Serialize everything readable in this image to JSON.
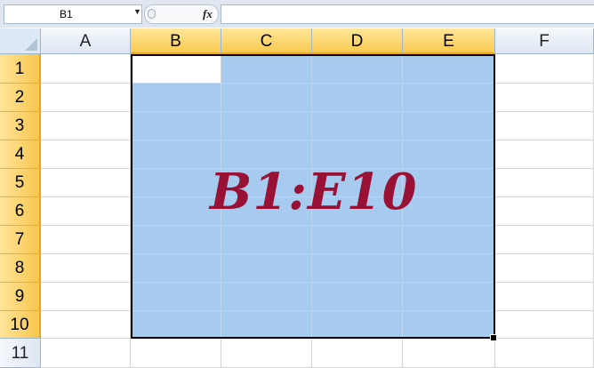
{
  "formula_bar": {
    "name_box": "B1",
    "name_box_dropdown_icon": "chevron-down-icon",
    "fx_label": "fx",
    "formula": ""
  },
  "columns": [
    "A",
    "B",
    "C",
    "D",
    "E",
    "F"
  ],
  "rows": [
    "1",
    "2",
    "3",
    "4",
    "5",
    "6",
    "7",
    "8",
    "9",
    "10",
    "11"
  ],
  "selection": {
    "range": "B1:E10",
    "active_cell": "B1",
    "highlight_color": "#a6cbee",
    "header_highlight_color": "#f9c94f"
  },
  "overlay": {
    "text": "B1:E10",
    "color": "#9a1136"
  }
}
